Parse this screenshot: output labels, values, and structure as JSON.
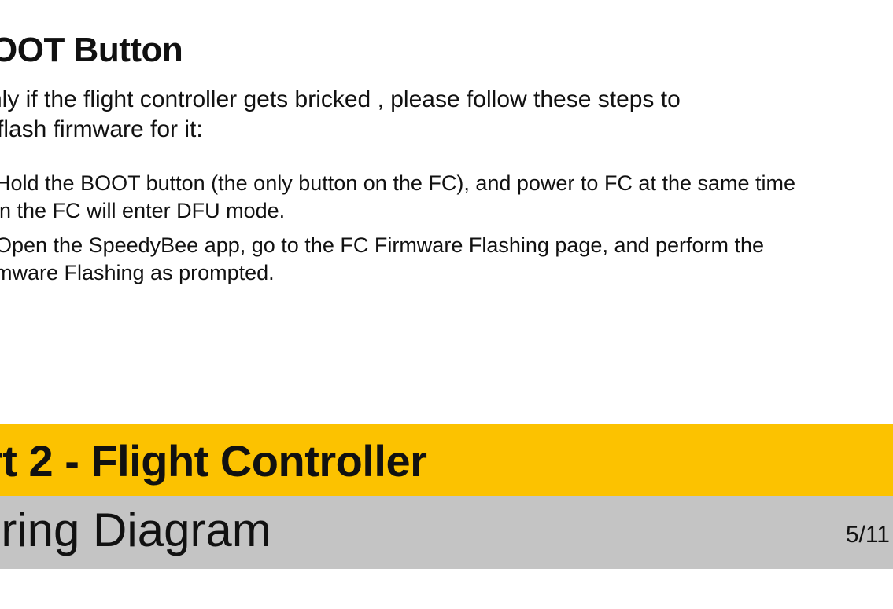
{
  "heading": "OOT Button",
  "intro": {
    "line1": "nly if the flight controller gets bricked , please follow these steps to",
    "line2": "-flash firmware for it:"
  },
  "steps": [
    {
      "line1": "Hold the BOOT button (the only button on the FC), and power to FC at the same time",
      "line2": "en the FC will enter DFU mode."
    },
    {
      "line1": "Open the SpeedyBee app, go to the FC Firmware Flashing page, and perform the",
      "line2": "rmware Flashing as prompted."
    }
  ],
  "section": {
    "title": "rt 2 - Flight Controller"
  },
  "subsection": {
    "title": "iring Diagram",
    "page_number": "5/11"
  },
  "colors": {
    "section_bar": "#fcc200",
    "subsection_bar": "#c4c4c4"
  }
}
